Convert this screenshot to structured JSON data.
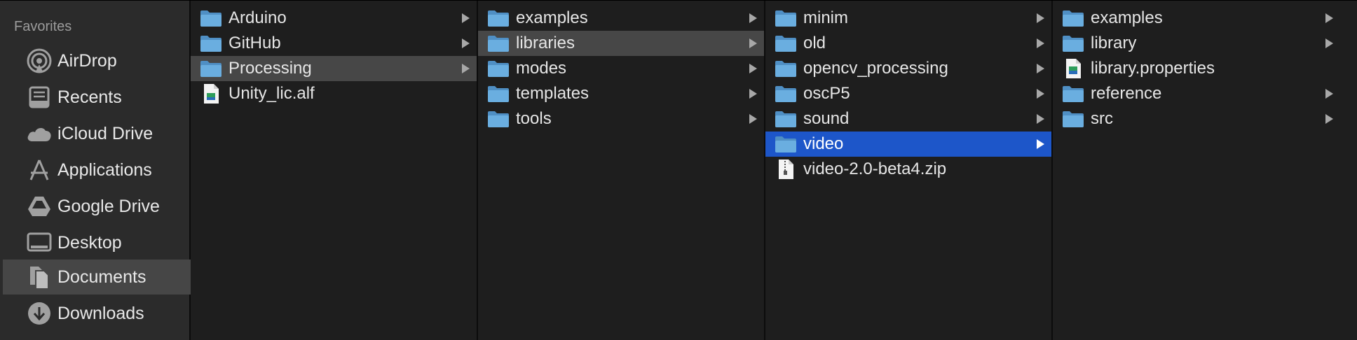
{
  "sidebar": {
    "title": "Favorites",
    "items": [
      {
        "label": "AirDrop",
        "icon": "airdrop-icon"
      },
      {
        "label": "Recents",
        "icon": "recents-icon"
      },
      {
        "label": "iCloud Drive",
        "icon": "cloud-icon"
      },
      {
        "label": "Applications",
        "icon": "applications-icon"
      },
      {
        "label": "Google Drive",
        "icon": "google-drive-icon"
      },
      {
        "label": "Desktop",
        "icon": "desktop-icon"
      },
      {
        "label": "Documents",
        "icon": "documents-icon",
        "selected": true
      },
      {
        "label": "Downloads",
        "icon": "downloads-icon"
      }
    ]
  },
  "columns": [
    {
      "items": [
        {
          "label": "Arduino",
          "type": "folder"
        },
        {
          "label": "GitHub",
          "type": "folder"
        },
        {
          "label": "Processing",
          "type": "folder",
          "state": "path"
        },
        {
          "label": "Unity_lic.alf",
          "type": "file"
        }
      ]
    },
    {
      "items": [
        {
          "label": "examples",
          "type": "folder"
        },
        {
          "label": "libraries",
          "type": "folder",
          "state": "path"
        },
        {
          "label": "modes",
          "type": "folder"
        },
        {
          "label": "templates",
          "type": "folder"
        },
        {
          "label": "tools",
          "type": "folder"
        }
      ]
    },
    {
      "items": [
        {
          "label": "minim",
          "type": "folder"
        },
        {
          "label": "old",
          "type": "folder"
        },
        {
          "label": "opencv_processing",
          "type": "folder"
        },
        {
          "label": "oscP5",
          "type": "folder"
        },
        {
          "label": "sound",
          "type": "folder"
        },
        {
          "label": "video",
          "type": "folder",
          "state": "selected"
        },
        {
          "label": "video-2.0-beta4.zip",
          "type": "zip"
        }
      ]
    },
    {
      "items": [
        {
          "label": "examples",
          "type": "folder"
        },
        {
          "label": "library",
          "type": "folder"
        },
        {
          "label": "library.properties",
          "type": "file"
        },
        {
          "label": "reference",
          "type": "folder"
        },
        {
          "label": "src",
          "type": "folder"
        }
      ]
    }
  ],
  "colors": {
    "selection_blue": "#1d56c9",
    "path_grey": "#474747",
    "folder_blue": "#5fa4d8"
  }
}
